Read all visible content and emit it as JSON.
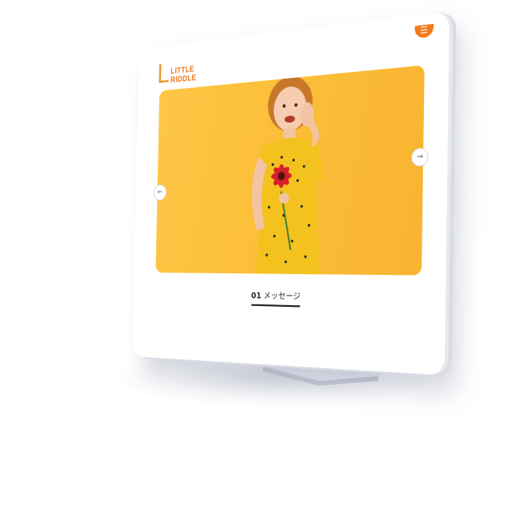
{
  "brand": {
    "mark": "L",
    "name_line1": "LITTLE",
    "name_line2": "RIDDLE",
    "primary_color": "#e8761c",
    "accent_color": "#f29a2e"
  },
  "header": {
    "menu_icon": "hamburger-icon",
    "menu_glyph": "☰"
  },
  "hero": {
    "background_color": "#fcc23e",
    "prev_glyph": "←",
    "next_glyph": "→",
    "image_subject": "girl-with-red-flower"
  },
  "section": {
    "number": "01",
    "title": "メッセージ"
  }
}
